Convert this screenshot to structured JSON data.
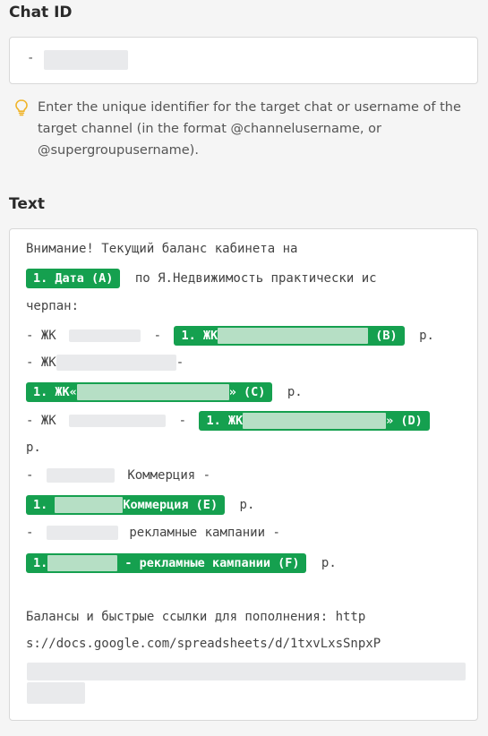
{
  "chat_id": {
    "label": "Chat ID",
    "value_prefix": "-",
    "hint": "Enter the unique identifier for the target chat or username of the target channel (in the format @channelusername, or @supergroupusername).",
    "hint_icon": "lightbulb-icon"
  },
  "text_field": {
    "label": "Text",
    "line1": "Внимание! Текущий баланс кабинета на",
    "chip_a": "1. Дата (A)",
    "line2_after": "по Я.Недвижимость практически ис",
    "line3": "черпан:",
    "l4_prefix": "- ЖК",
    "l4_dash": "-",
    "chip_b_prefix": "1. ЖК",
    "chip_b_suffix": "(B)",
    "rub": "р.",
    "l5_prefix": "- ЖК",
    "l5_suffix": "-",
    "chip_c_prefix": "1. ЖК«",
    "chip_c_suffix": "» (C)",
    "l7_prefix": "- ЖК",
    "l7_dash": "-",
    "chip_d_prefix": "1. ЖК",
    "chip_d_suffix": "» (D)",
    "l9_prefix": "-",
    "l9_suffix": "Коммерция -",
    "chip_e_prefix": "1.",
    "chip_e_suffix": "Коммерция (E)",
    "l11_prefix": "-",
    "l11_suffix": "рекламные кампании -",
    "chip_f_prefix": "1.",
    "chip_f_suffix": "- рекламные кампании (F)",
    "line_b1": "Балансы и быстрые ссылки для пополнения: http",
    "line_b2": "s://docs.google.com/spreadsheets/d/1txvLxsSnpxP"
  },
  "colors": {
    "chip_bg": "#15a04f",
    "hint_icon": "#f0b429",
    "background": "#f5f5f5"
  }
}
